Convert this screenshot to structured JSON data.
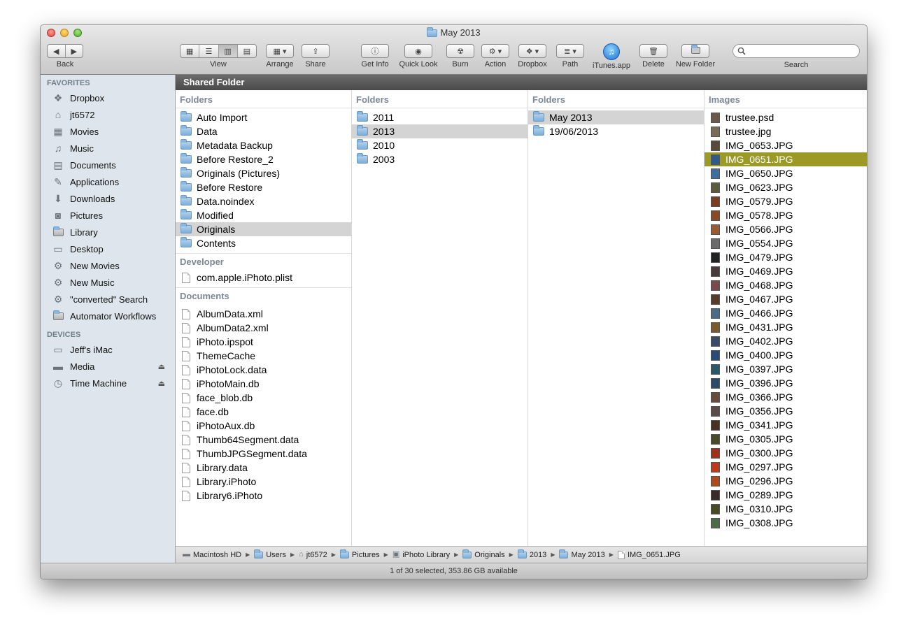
{
  "window": {
    "title": "May 2013"
  },
  "toolbar": {
    "back_label": "Back",
    "view_label": "View",
    "arrange_label": "Arrange",
    "share_label": "Share",
    "getinfo_label": "Get Info",
    "quicklook_label": "Quick Look",
    "burn_label": "Burn",
    "action_label": "Action",
    "dropbox_label": "Dropbox",
    "path_label": "Path",
    "itunes_label": "iTunes.app",
    "delete_label": "Delete",
    "newfolder_label": "New Folder",
    "search_label": "Search",
    "search_value": ""
  },
  "sidebar": {
    "favorites_heading": "FAVORITES",
    "favorites": [
      {
        "label": "Dropbox",
        "icon": "dropbox-icon"
      },
      {
        "label": "jt6572",
        "icon": "home-icon"
      },
      {
        "label": "Movies",
        "icon": "film-icon"
      },
      {
        "label": "Music",
        "icon": "music-note-icon"
      },
      {
        "label": "Documents",
        "icon": "documents-icon"
      },
      {
        "label": "Applications",
        "icon": "applications-icon"
      },
      {
        "label": "Downloads",
        "icon": "download-icon"
      },
      {
        "label": "Pictures",
        "icon": "camera-icon"
      },
      {
        "label": "Library",
        "icon": "folder-icon"
      },
      {
        "label": "Desktop",
        "icon": "desktop-icon"
      },
      {
        "label": "New Movies",
        "icon": "gear-icon"
      },
      {
        "label": "New Music",
        "icon": "gear-icon"
      },
      {
        "label": "\"converted\" Search",
        "icon": "gear-icon"
      },
      {
        "label": "Automator Workflows",
        "icon": "folder-icon"
      }
    ],
    "devices_heading": "DEVICES",
    "devices": [
      {
        "label": "Jeff's iMac",
        "icon": "imac-icon"
      },
      {
        "label": "Media",
        "icon": "drive-icon"
      },
      {
        "label": "Time Machine",
        "icon": "time-machine-icon"
      }
    ]
  },
  "path_header": "Shared Folder",
  "columns": {
    "col1": {
      "folders_heading": "Folders",
      "folders": [
        "Auto Import",
        "Data",
        "Metadata Backup",
        "Before Restore_2",
        "Originals (Pictures)",
        "Before Restore",
        "Data.noindex",
        "Modified",
        "Originals",
        "Contents"
      ],
      "developer_heading": "Developer",
      "developer": [
        "com.apple.iPhoto.plist"
      ],
      "documents_heading": "Documents",
      "documents": [
        "AlbumData.xml",
        "AlbumData2.xml",
        "iPhoto.ipspot",
        "ThemeCache",
        "iPhotoLock.data",
        "iPhotoMain.db",
        "face_blob.db",
        "face.db",
        "iPhotoAux.db",
        "Thumb64Segment.data",
        "ThumbJPGSegment.data",
        "Library.data",
        "Library.iPhoto",
        "Library6.iPhoto"
      ]
    },
    "col2": {
      "heading": "Folders",
      "items": [
        "2011",
        "2013",
        "2010",
        "2003"
      ]
    },
    "col3": {
      "heading": "Folders",
      "items": [
        "May 2013",
        "19/06/2013"
      ]
    },
    "col4": {
      "heading": "Images",
      "items": [
        "trustee.psd",
        "trustee.jpg",
        "IMG_0653.JPG",
        "IMG_0651.JPG",
        "IMG_0650.JPG",
        "IMG_0623.JPG",
        "IMG_0579.JPG",
        "IMG_0578.JPG",
        "IMG_0566.JPG",
        "IMG_0554.JPG",
        "IMG_0479.JPG",
        "IMG_0469.JPG",
        "IMG_0468.JPG",
        "IMG_0467.JPG",
        "IMG_0466.JPG",
        "IMG_0431.JPG",
        "IMG_0402.JPG",
        "IMG_0400.JPG",
        "IMG_0397.JPG",
        "IMG_0396.JPG",
        "IMG_0366.JPG",
        "IMG_0356.JPG",
        "IMG_0341.JPG",
        "IMG_0305.JPG",
        "IMG_0300.JPG",
        "IMG_0297.JPG",
        "IMG_0296.JPG",
        "IMG_0289.JPG",
        "IMG_0310.JPG",
        "IMG_0308.JPG"
      ]
    }
  },
  "breadcrumb": [
    "Macintosh HD",
    "Users",
    "jt6572",
    "Pictures",
    "iPhoto Library",
    "Originals",
    "2013",
    "May 2013",
    "IMG_0651.JPG"
  ],
  "status": "1 of 30 selected, 353.86 GB available",
  "colors": {
    "selection_active": "#9c9a27",
    "selection_inactive": "#d4d4d4",
    "sidebar_bg": "#dfe5ec"
  }
}
